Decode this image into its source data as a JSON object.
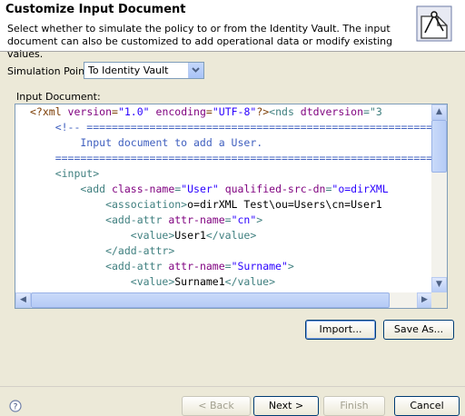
{
  "header": {
    "title": "Customize Input Document",
    "description": "Select whether to simulate the policy to or from the Identity Vault. The input document can also be customized to add operational data or modify existing values.",
    "icon": "document-compass-icon"
  },
  "simulation": {
    "label": "Simulation Point:",
    "selected": "To Identity Vault"
  },
  "editor": {
    "label": "Input Document:",
    "lines": [
      [
        [
          "pi",
          "<?xml "
        ],
        [
          "attr",
          "version"
        ],
        [
          "pi",
          "="
        ],
        [
          "val",
          "\"1.0\""
        ],
        [
          "pi",
          " "
        ],
        [
          "attr",
          "encoding"
        ],
        [
          "pi",
          "="
        ],
        [
          "val",
          "\"UTF-8\""
        ],
        [
          "pi",
          "?>"
        ],
        [
          "tag",
          "<nds "
        ],
        [
          "attr",
          "dtdversion"
        ],
        [
          "tag",
          "=\"3"
        ]
      ],
      [
        [
          "cm",
          "    <!-- ========================================================"
        ]
      ],
      [
        [
          "cm",
          "        Input document to add a User."
        ]
      ],
      [
        [
          "cm",
          "    ============================================================"
        ]
      ],
      [
        [
          "tag",
          "    <input>"
        ]
      ],
      [
        [
          "tag",
          "        <add "
        ],
        [
          "attr",
          "class-name"
        ],
        [
          "tag",
          "="
        ],
        [
          "val",
          "\"User\""
        ],
        [
          "tag",
          " "
        ],
        [
          "attr",
          "qualified-src-dn"
        ],
        [
          "tag",
          "="
        ],
        [
          "val",
          "\"o=dirXML"
        ]
      ],
      [
        [
          "tag",
          "            <association>"
        ],
        [
          "txt",
          "o=dirXML Test\\ou=Users\\cn=User1"
        ]
      ],
      [
        [
          "tag",
          "            <add-attr "
        ],
        [
          "attr",
          "attr-name"
        ],
        [
          "tag",
          "="
        ],
        [
          "val",
          "\"cn\""
        ],
        [
          "tag",
          ">"
        ]
      ],
      [
        [
          "tag",
          "                <value>"
        ],
        [
          "txt",
          "User1"
        ],
        [
          "tag",
          "</value>"
        ]
      ],
      [
        [
          "tag",
          "            </add-attr>"
        ]
      ],
      [
        [
          "tag",
          "            <add-attr "
        ],
        [
          "attr",
          "attr-name"
        ],
        [
          "tag",
          "="
        ],
        [
          "val",
          "\"Surname\""
        ],
        [
          "tag",
          ">"
        ]
      ],
      [
        [
          "tag",
          "                <value>"
        ],
        [
          "txt",
          "Surname1"
        ],
        [
          "tag",
          "</value>"
        ]
      ]
    ]
  },
  "buttons": {
    "import": "Import...",
    "save_as": "Save As...",
    "back": "< Back",
    "next": "Next >",
    "finish": "Finish",
    "cancel": "Cancel"
  }
}
